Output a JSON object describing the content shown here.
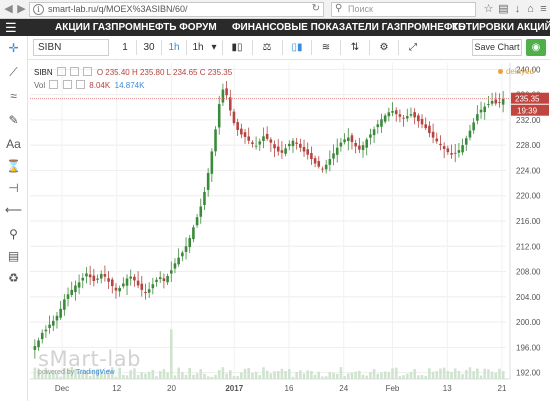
{
  "browser": {
    "url": "smart-lab.ru/q/MOEX%3ASIBN/60/",
    "search_placeholder": "Поиск"
  },
  "site_nav": {
    "items": [
      "АКЦИИ ГАЗПРОМНЕФТЬ ФОРУМ",
      "ФИНАНСОВЫЕ ПОКАЗАТЕЛИ ГАЗПРОМНЕФТЬ",
      "КОТИРОВКИ АКЦИЙ"
    ]
  },
  "toolbar": {
    "symbol": "SIBN",
    "intervals": [
      "1",
      "30",
      "1h",
      "1h"
    ],
    "active_interval": "1h",
    "save_label": "Save Chart"
  },
  "legend": {
    "symbol": "SIBN",
    "ohlc": "O 235.40  H 235.80  L 234.65  C 235.35",
    "volume_label": "Vol",
    "volume_values": [
      "8.04K",
      "14.874K"
    ],
    "status": "delayed"
  },
  "watermark": {
    "brand": "sMart-lab",
    "powered_by": "powered by",
    "tradingview": "TradingView"
  },
  "colors": {
    "up": "#3b8a3a",
    "down": "#b5433f",
    "accent": "#3b8bd8",
    "price_label": "#c0453e"
  },
  "chart_data": {
    "type": "candlestick",
    "ylim": [
      191,
      241
    ],
    "y_ticks": [
      192,
      196,
      200,
      204,
      208,
      212,
      216,
      220,
      224,
      228,
      232,
      236,
      240
    ],
    "x_ticks": [
      {
        "label": "Dec",
        "bold": false
      },
      {
        "label": "12",
        "bold": false
      },
      {
        "label": "20",
        "bold": false
      },
      {
        "label": "2017",
        "bold": true
      },
      {
        "label": "16",
        "bold": false
      },
      {
        "label": "24",
        "bold": false
      },
      {
        "label": "Feb",
        "bold": false
      },
      {
        "label": "13",
        "bold": false
      },
      {
        "label": "21",
        "bold": false
      }
    ],
    "last_price": "235.35",
    "countdown": "19:39",
    "price_line": 235.35,
    "close_series": [
      196.2,
      197.1,
      198.3,
      198.8,
      199.6,
      200.2,
      201.0,
      202.1,
      203.6,
      204.4,
      205.1,
      205.8,
      206.3,
      207.0,
      207.7,
      207.1,
      206.5,
      206.9,
      207.6,
      207.2,
      206.4,
      205.7,
      205.0,
      205.4,
      206.1,
      206.9,
      207.2,
      206.6,
      205.8,
      205.1,
      204.6,
      205.2,
      206.0,
      206.7,
      207.1,
      206.5,
      207.3,
      208.2,
      209.3,
      210.2,
      211.0,
      212.0,
      213.3,
      215.0,
      216.6,
      218.3,
      220.6,
      223.6,
      227.0,
      230.5,
      234.5,
      236.8,
      235.9,
      233.5,
      231.5,
      230.4,
      229.7,
      229.3,
      228.7,
      228.2,
      227.9,
      228.6,
      229.4,
      229.0,
      228.4,
      227.5,
      227.0,
      226.8,
      227.5,
      228.2,
      228.7,
      228.2,
      227.6,
      227.0,
      226.5,
      225.8,
      225.1,
      224.6,
      224.2,
      224.9,
      225.8,
      226.7,
      227.6,
      228.4,
      228.9,
      229.2,
      228.5,
      227.8,
      227.3,
      228.0,
      228.9,
      229.7,
      230.5,
      231.3,
      232.1,
      232.7,
      233.2,
      233.4,
      232.9,
      232.5,
      232.2,
      232.6,
      232.9,
      232.4,
      231.8,
      231.3,
      230.7,
      229.9,
      229.2,
      228.6,
      228.0,
      227.4,
      226.9,
      226.5,
      226.7,
      227.2,
      228.0,
      229.1,
      230.3,
      231.6,
      232.9,
      233.6,
      234.1,
      234.5,
      235.0,
      234.6,
      234.8,
      235.3
    ]
  }
}
